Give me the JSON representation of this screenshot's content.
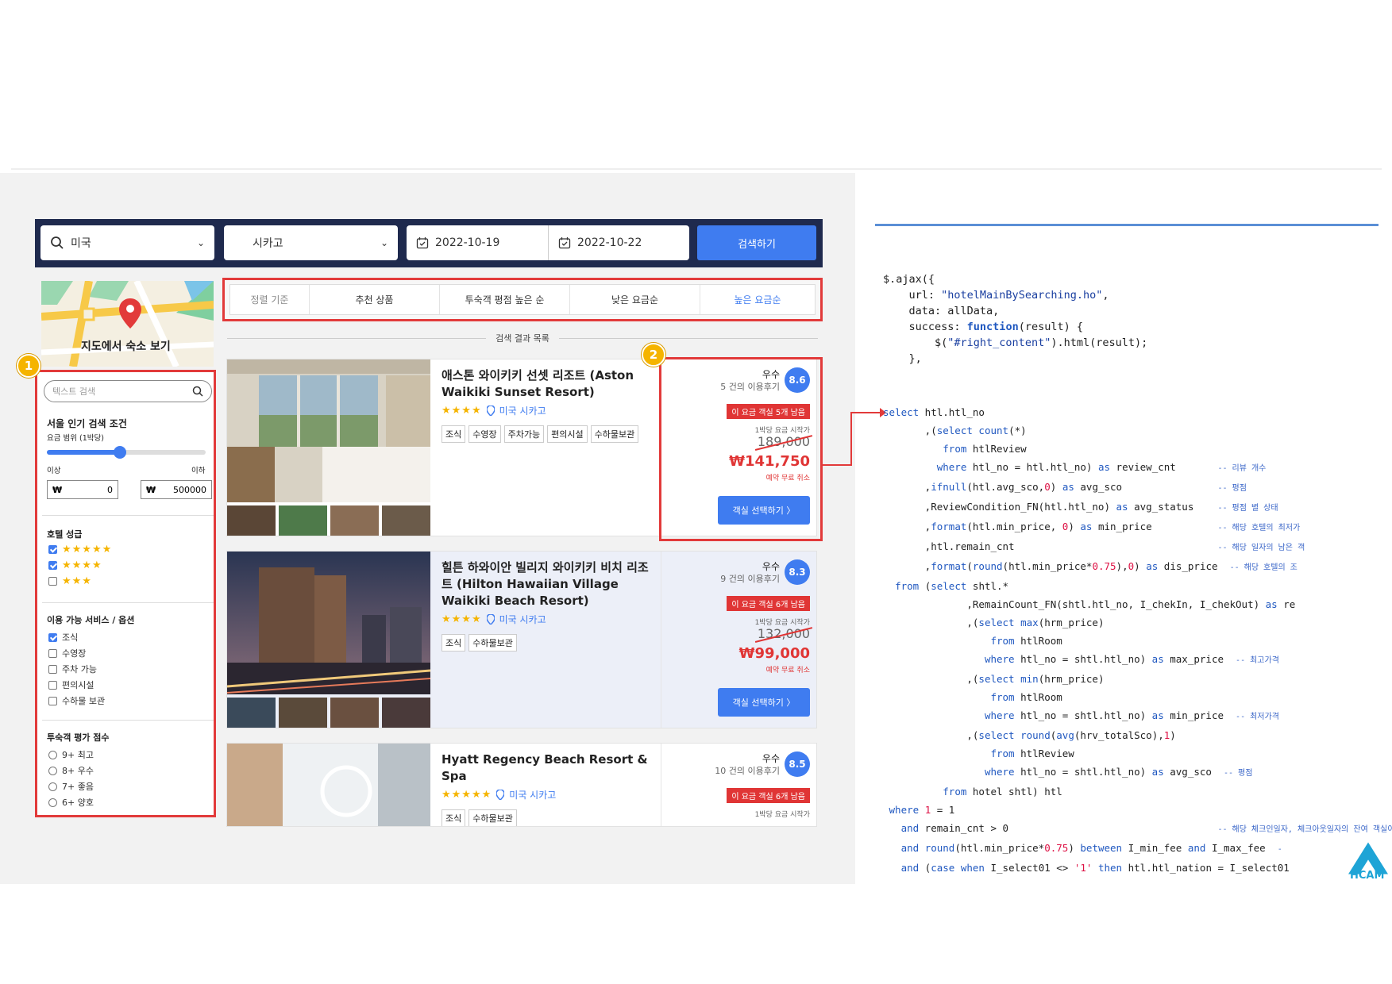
{
  "search": {
    "country": "미국",
    "city": "시카고",
    "checkin": "2022-10-19",
    "checkout": "2022-10-22",
    "button": "검색하기"
  },
  "map": {
    "label": "지도에서 숙소 보기"
  },
  "filters": {
    "text_search_placeholder": "텍스트 검색",
    "popular_title": "서울 인기 검색 조건",
    "price_range_label": "요금 범위 (1박당)",
    "min_label": "이상",
    "max_label": "이하",
    "currency": "₩",
    "min_value": "0",
    "max_value": "500000",
    "slider_fraction": 0.46,
    "grade_title": "호텔 성급",
    "grades": [
      {
        "stars": "★★★★★",
        "checked": true
      },
      {
        "stars": "★★★★",
        "checked": true
      },
      {
        "stars": "★★★",
        "checked": false
      }
    ],
    "services_title": "이용 가능 서비스 / 옵션",
    "services": [
      {
        "label": "조식",
        "checked": true
      },
      {
        "label": "수영장",
        "checked": false
      },
      {
        "label": "주차 가능",
        "checked": false
      },
      {
        "label": "편의시설",
        "checked": false
      },
      {
        "label": "수하물 보관",
        "checked": false
      }
    ],
    "score_title": "투숙객 평가 점수",
    "scores": [
      "9+ 최고",
      "8+ 우수",
      "7+ 좋음",
      "6+ 양호"
    ]
  },
  "sort": {
    "items": [
      "정렬 기준",
      "추천 상품",
      "투숙객 평점 높은 순",
      "낮은 요금순",
      "높은 요금순"
    ]
  },
  "results_title": "검색 결과 목록",
  "callouts": [
    "1",
    "2"
  ],
  "hotels": [
    {
      "name": "애스톤 와이키키 선셋 리조트 (Aston Waikiki Sunset Resort)",
      "stars": "★★★★",
      "location": "미국 시카고",
      "tags": [
        "조식",
        "수영장",
        "주차가능",
        "편의시설",
        "수하물보관"
      ],
      "grade": "우수",
      "reviews": "5 건의 이용후기",
      "score": "8.6",
      "remaining": "이 요금 객실 5개 남음",
      "from_label": "1박당 요금 시작가",
      "original_price": "189,000",
      "sale_price": "₩141,750",
      "cancel": "예약 무료 취소",
      "button": "객실 선택하기 〉"
    },
    {
      "name": "힐튼 하와이안 빌리지 와이키키 비치 리조트 (Hilton Hawaiian Village Waikiki Beach Resort)",
      "stars": "★★★★",
      "location": "미국 시카고",
      "tags": [
        "조식",
        "수하물보관"
      ],
      "grade": "우수",
      "reviews": "9 건의 이용후기",
      "score": "8.3",
      "remaining": "이 요금 객실 6개 남음",
      "from_label": "1박당 요금 시작가",
      "original_price": "132,000",
      "sale_price": "₩99,000",
      "cancel": "예약 무료 취소",
      "button": "객실 선택하기 〉"
    },
    {
      "name": "Hyatt Regency Beach Resort & Spa",
      "stars": "★★★★★",
      "location": "미국 시카고",
      "tags": [
        "조식",
        "수하물보관"
      ],
      "grade": "우수",
      "reviews": "10 건의 이용후기",
      "score": "8.5",
      "remaining": "이 요금 객실 6개 남음",
      "from_label": "1박당 요금 시작가",
      "original_price": "",
      "sale_price": "",
      "cancel": "",
      "button": ""
    }
  ],
  "code": {
    "ajax": [
      "$.ajax({",
      "    url: \"hotelMainBySearching.ho\",",
      "    data: allData,",
      "    success: function(result) {",
      "        $(\"#right_content\").html(result);",
      "    },"
    ],
    "sql": [
      {
        "code": "select htl.htl_no",
        "comment": ""
      },
      {
        "code": "       ,(select count(*)",
        "comment": ""
      },
      {
        "code": "          from htlReview",
        "comment": ""
      },
      {
        "code": "         where htl_no = htl.htl_no) as review_cnt",
        "comment": "-- 리뷰 개수"
      },
      {
        "code": "       ,ifnull(htl.avg_sco,0) as avg_sco",
        "comment": "-- 평점"
      },
      {
        "code": "       ,ReviewCondition_FN(htl.htl_no) as avg_status",
        "comment": "-- 평점 별 상태"
      },
      {
        "code": "       ,format(htl.min_price, 0) as min_price",
        "comment": "-- 해당 호텔의 최저가"
      },
      {
        "code": "       ,htl.remain_cnt",
        "comment": "-- 해당 일자의 남은 객"
      },
      {
        "code": "       ,format(round(htl.min_price*0.75),0) as dis_price",
        "comment": "-- 해당 호텔의 조"
      },
      {
        "code": "  from (select shtl.*",
        "comment": ""
      },
      {
        "code": "              ,RemainCount_FN(shtl.htl_no, I_chekIn, I_chekOut) as re",
        "comment": ""
      },
      {
        "code": "              ,(select max(hrm_price)",
        "comment": ""
      },
      {
        "code": "                  from htlRoom",
        "comment": ""
      },
      {
        "code": "                 where htl_no = shtl.htl_no) as max_price",
        "comment": "-- 최고가격"
      },
      {
        "code": "              ,(select min(hrm_price)",
        "comment": ""
      },
      {
        "code": "                  from htlRoom",
        "comment": ""
      },
      {
        "code": "                 where htl_no = shtl.htl_no) as min_price",
        "comment": "-- 최저가격"
      },
      {
        "code": "              ,(select round(avg(hrv_totalSco),1)",
        "comment": ""
      },
      {
        "code": "                  from htlReview",
        "comment": ""
      },
      {
        "code": "                 where htl_no = shtl.htl_no) as avg_sco",
        "comment": "-- 평점"
      },
      {
        "code": "          from hotel shtl) htl",
        "comment": ""
      },
      {
        "code": " where 1 = 1",
        "comment": ""
      },
      {
        "code": "   and remain_cnt > 0",
        "comment": "-- 해당 체크인일자, 체크아웃일자의 잔여 객실이 있"
      },
      {
        "code": "   and round(htl.min_price*0.75) between I_min_fee and I_max_fee",
        "comment": "-"
      },
      {
        "code": "   and (case when I_select01 <> '1' then htl.htl_nation = I_select01",
        "comment": ""
      }
    ]
  },
  "logo": {
    "text": "HCAM"
  },
  "colors": {
    "accent": "#3f7cf0",
    "highlight": "#e23a3a",
    "navy": "#1f2a4e",
    "callout": "#f5b400"
  }
}
